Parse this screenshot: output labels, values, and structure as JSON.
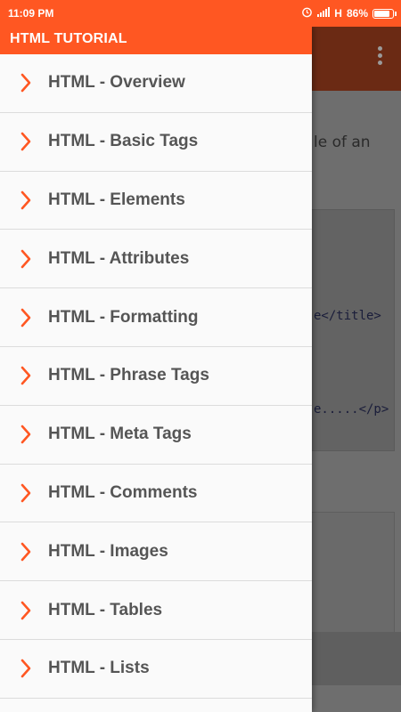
{
  "status_bar": {
    "time": "11:09 PM",
    "network": "H",
    "battery_percent": "86%",
    "battery_level": 0.86,
    "icons": [
      "alarm-icon",
      "signal-icon",
      "battery-icon"
    ]
  },
  "drawer": {
    "title": "HTML TUTORIAL",
    "items": [
      {
        "label": "HTML - Overview"
      },
      {
        "label": "HTML - Basic Tags"
      },
      {
        "label": "HTML - Elements"
      },
      {
        "label": "HTML - Attributes"
      },
      {
        "label": "HTML - Formatting"
      },
      {
        "label": "HTML - Phrase Tags"
      },
      {
        "label": "HTML - Meta Tags"
      },
      {
        "label": "HTML - Comments"
      },
      {
        "label": "HTML - Images"
      },
      {
        "label": "HTML - Tables"
      },
      {
        "label": "HTML - Lists"
      }
    ]
  },
  "background": {
    "text_fragment": "le of an",
    "code_line_1": "e</title>",
    "code_line_2": "e.....</p>"
  },
  "colors": {
    "accent": "#ff5722",
    "chevron": "#ff5722",
    "label": "#555555"
  }
}
